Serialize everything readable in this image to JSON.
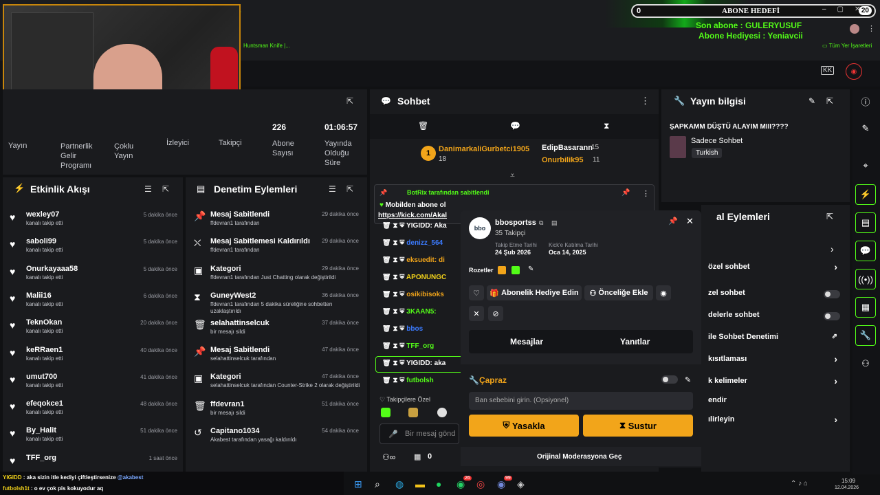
{
  "stream_overlay": {
    "goal_left": "0",
    "goal_title": "ABONE HEDEFİ",
    "goal_right": "20",
    "last_sub": "Son abone : GULERYUSUF",
    "sub_gift": "Abone Hediyesi : Yeniavcii",
    "bookmarks_left": "Huntsman Knife |...",
    "bookmarks_right": "Tüm Yer İşaretleri"
  },
  "stats": {
    "items": [
      {
        "label": "Yayın"
      },
      {
        "label": "Partnerlik Gelir Programı"
      },
      {
        "label": "Çoklu Yayın"
      },
      {
        "label": "İzleyici"
      },
      {
        "label": "Takipçi"
      },
      {
        "value": "226",
        "label": "Abone Sayısı"
      },
      {
        "value": "01:06:57",
        "label": "Yayında Olduğu Süre"
      }
    ]
  },
  "activity": {
    "title": "Etkinlik Akışı",
    "items": [
      {
        "name": "wexley07",
        "sub": "kanalı takip etti",
        "time": "5 dakika önce"
      },
      {
        "name": "saboli99",
        "sub": "kanalı takip etti",
        "time": "5 dakika önce"
      },
      {
        "name": "Onurkayaaa58",
        "sub": "kanalı takip etti",
        "time": "5 dakika önce"
      },
      {
        "name": "Malii16",
        "sub": "kanalı takip etti",
        "time": "6 dakika önce"
      },
      {
        "name": "TeknOkan",
        "sub": "kanalı takip etti",
        "time": "20 dakika önce"
      },
      {
        "name": "keRRaen1",
        "sub": "kanalı takip etti",
        "time": "40 dakika önce"
      },
      {
        "name": "umut700",
        "sub": "kanalı takip etti",
        "time": "41 dakika önce"
      },
      {
        "name": "efeqokce1",
        "sub": "kanalı takip etti",
        "time": "48 dakika önce"
      },
      {
        "name": "By_Halit",
        "sub": "kanalı takip etti",
        "time": "51 dakika önce"
      },
      {
        "name": "TFF_org",
        "sub": "",
        "time": "1 saat önce"
      }
    ]
  },
  "moderation": {
    "title": "Denetim Eylemleri",
    "items": [
      {
        "name": "Mesaj Sabitlendi",
        "sub": "ffdevran1 tarafından",
        "time": "29 dakika önce"
      },
      {
        "name": "Mesaj Sabitlemesi Kaldırıldı",
        "sub": "ffdevran1 tarafından",
        "time": "29 dakika önce"
      },
      {
        "name": "Kategori",
        "sub": "ffdevran1 tarafından Just Chatting olarak değiştirildi",
        "time": "29 dakika önce"
      },
      {
        "name": "GuneyWest2",
        "sub": "ffdevran1 tarafından 5 dakika süreliğine sohbetten uzaklaştırıldı",
        "time": "36 dakika önce"
      },
      {
        "name": "selahattinselcuk",
        "sub": "bir mesajı sildi",
        "time": "37 dakika önce"
      },
      {
        "name": "Mesaj Sabitlendi",
        "sub": "selahattinselcuk tarafından",
        "time": "47 dakika önce"
      },
      {
        "name": "Kategori",
        "sub": "selahattinselcuk tarafından Counter-Strike 2 olarak değiştirildi",
        "time": "47 dakika önce"
      },
      {
        "name": "ffdevran1",
        "sub": "bir mesajı sildi",
        "time": "51 dakika önce"
      },
      {
        "name": "Capitano1034",
        "sub": "Akabest tarafından yasağı kaldırıldı",
        "time": "54 dakika önce"
      }
    ]
  },
  "chat": {
    "title": "Sohbet",
    "top1_name": "DanimarkaliGurbetci1905",
    "top1_count": "18",
    "top2_name": "EdipBasarann",
    "top2_count": "15",
    "top3_name": "Onurbilik95",
    "top3_count": "11",
    "pinned_by": "BotRix tarafından sabitlendi",
    "pinned_text": "Mobilden abone ol",
    "pinned_link": "https://kick.com/Akal",
    "lines": [
      "YIGIDD: Aka",
      "denizz_564",
      "eksuedit: di",
      "APONUNGC",
      "osikibisoks",
      "3KAAN5:",
      "bbos",
      "TFF_org",
      "YIGIDD: aka",
      "futbolsh"
    ],
    "followers_only": "Takipçilere Özel",
    "input_placeholder": "Bir mesaj gönd",
    "count": "0"
  },
  "usercard": {
    "username": "bbosportss",
    "followers": "35 Takipçi",
    "follow_date_label": "Takip Etme Tarihi",
    "follow_date": "24 Şub 2026",
    "join_label": "Kick'e Katılma Tarihi",
    "join_date": "Oca 14, 2025",
    "badges_label": "Rozetler",
    "gift_btn": "Abonelik Hediye Edin",
    "prio_btn": "Önceliğe Ekle",
    "tab_messages": "Mesajlar",
    "tab_replies": "Yanıtlar",
    "cross_label": "Çapraz",
    "ban_placeholder": "Ban sebebini girin. (Opsiyonel)",
    "ban_btn": "Yasakla",
    "mute_btn": "Sustur",
    "switch_mod": "Orijinal Moderasyona Geç"
  },
  "stream_info": {
    "title": "Yayın bilgisi",
    "stream_title": "ŞAPKAMM DÜŞTÜ ALAYIM MIII????",
    "category": "Sadece Sohbet",
    "language": "Turkish"
  },
  "mod_actions2": {
    "title": "al Eylemleri",
    "items": [
      "özel sohbet",
      "zel sohbet",
      "delerle sohbet",
      "ile Sohbet Denetimi",
      "kısıtlaması",
      "k kelimeler",
      "endir",
      "ılirleyin"
    ]
  },
  "bottom_chat": {
    "line1_user": "YIGIDD",
    "line1_text": ": aka sizin itle kediyi çiftleştirsenize",
    "line1_mention": "@akabest",
    "line2_user": "futbolsh1t",
    "line2_text": ": o ev çok pis kokuyodur aq"
  },
  "taskbar": {
    "time": "15:09",
    "date": "12.04.2026",
    "badge1": "26",
    "badge2": "99"
  }
}
